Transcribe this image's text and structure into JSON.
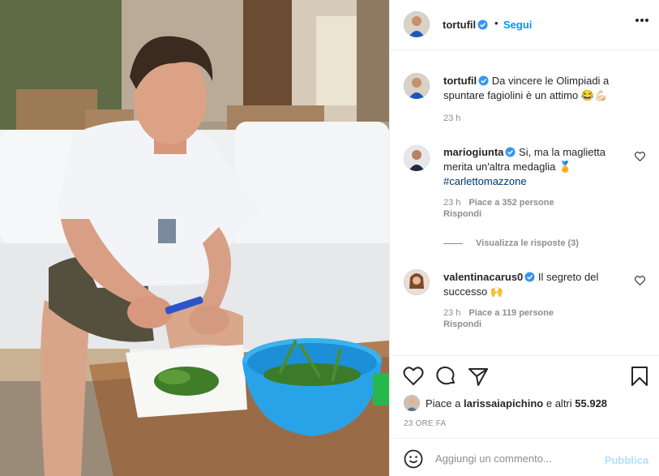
{
  "post": {
    "author": "tortufil",
    "separator": "•",
    "follow_label": "Segui",
    "more_icon": "more-options-icon",
    "caption": "Da vincere le Olimpiadi a spuntare fagiolini è un attimo 😂💪🏻",
    "caption_time": "23 h"
  },
  "comments": [
    {
      "user": "mariogiunta",
      "text": "Si, ma la maglietta merita un'altra medaglia 🏅",
      "hashtag": "#carlettomazzone",
      "time": "23 h",
      "likes": "Piace a 352 persone",
      "reply": "Rispondi",
      "view_replies": "Visualizza le risposte (3)"
    },
    {
      "user": "valentinacarus0",
      "text": "Il segreto del successo 🙌",
      "time": "23 h",
      "likes": "Piace a 119 persone",
      "reply": "Rispondi"
    }
  ],
  "likes": {
    "prefix": "Piace a ",
    "user": "larissaiapichino",
    "suffix": " e altri ",
    "count": "55.928"
  },
  "timestamp": "23 ORE FA",
  "add_comment": {
    "placeholder": "Aggiungi un commento...",
    "publish_label": "Pubblica"
  },
  "colors": {
    "accent": "#0095f6",
    "verified": "#3897f0",
    "publish_disabled": "#b2dffc",
    "bowl": "#29a3e8"
  }
}
